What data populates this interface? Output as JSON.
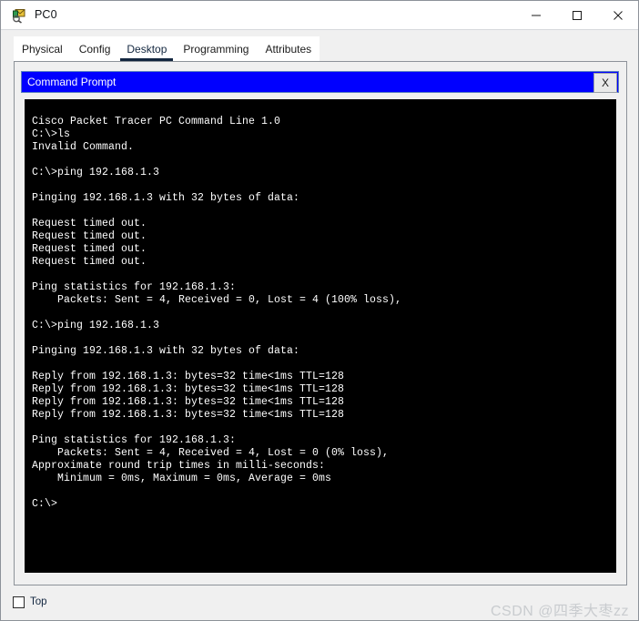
{
  "window": {
    "title": "PC0",
    "icon": "packet-tracer-pc-icon",
    "controls": {
      "minimize": "minimize-icon",
      "maximize": "maximize-icon",
      "close": "close-icon"
    }
  },
  "tabs": [
    {
      "label": "Physical",
      "active": false
    },
    {
      "label": "Config",
      "active": false
    },
    {
      "label": "Desktop",
      "active": true
    },
    {
      "label": "Programming",
      "active": false
    },
    {
      "label": "Attributes",
      "active": false
    }
  ],
  "command_prompt": {
    "title": "Command Prompt",
    "close_label": "X",
    "titlebar_color": "#0000ff",
    "background_color": "#000000",
    "text_color": "#ffffff",
    "lines": [
      "Cisco Packet Tracer PC Command Line 1.0",
      "C:\\>ls",
      "Invalid Command.",
      "",
      "C:\\>ping 192.168.1.3",
      "",
      "Pinging 192.168.1.3 with 32 bytes of data:",
      "",
      "Request timed out.",
      "Request timed out.",
      "Request timed out.",
      "Request timed out.",
      "",
      "Ping statistics for 192.168.1.3:",
      "    Packets: Sent = 4, Received = 0, Lost = 4 (100% loss),",
      "",
      "C:\\>ping 192.168.1.3",
      "",
      "Pinging 192.168.1.3 with 32 bytes of data:",
      "",
      "Reply from 192.168.1.3: bytes=32 time<1ms TTL=128",
      "Reply from 192.168.1.3: bytes=32 time<1ms TTL=128",
      "Reply from 192.168.1.3: bytes=32 time<1ms TTL=128",
      "Reply from 192.168.1.3: bytes=32 time<1ms TTL=128",
      "",
      "Ping statistics for 192.168.1.3:",
      "    Packets: Sent = 4, Received = 4, Lost = 0 (0% loss),",
      "Approximate round trip times in milli-seconds:",
      "    Minimum = 0ms, Maximum = 0ms, Average = 0ms",
      "",
      "C:\\>"
    ]
  },
  "footer": {
    "top_checkbox_label": "Top",
    "top_checkbox_checked": false,
    "watermark": "CSDN @四季大枣zz"
  }
}
